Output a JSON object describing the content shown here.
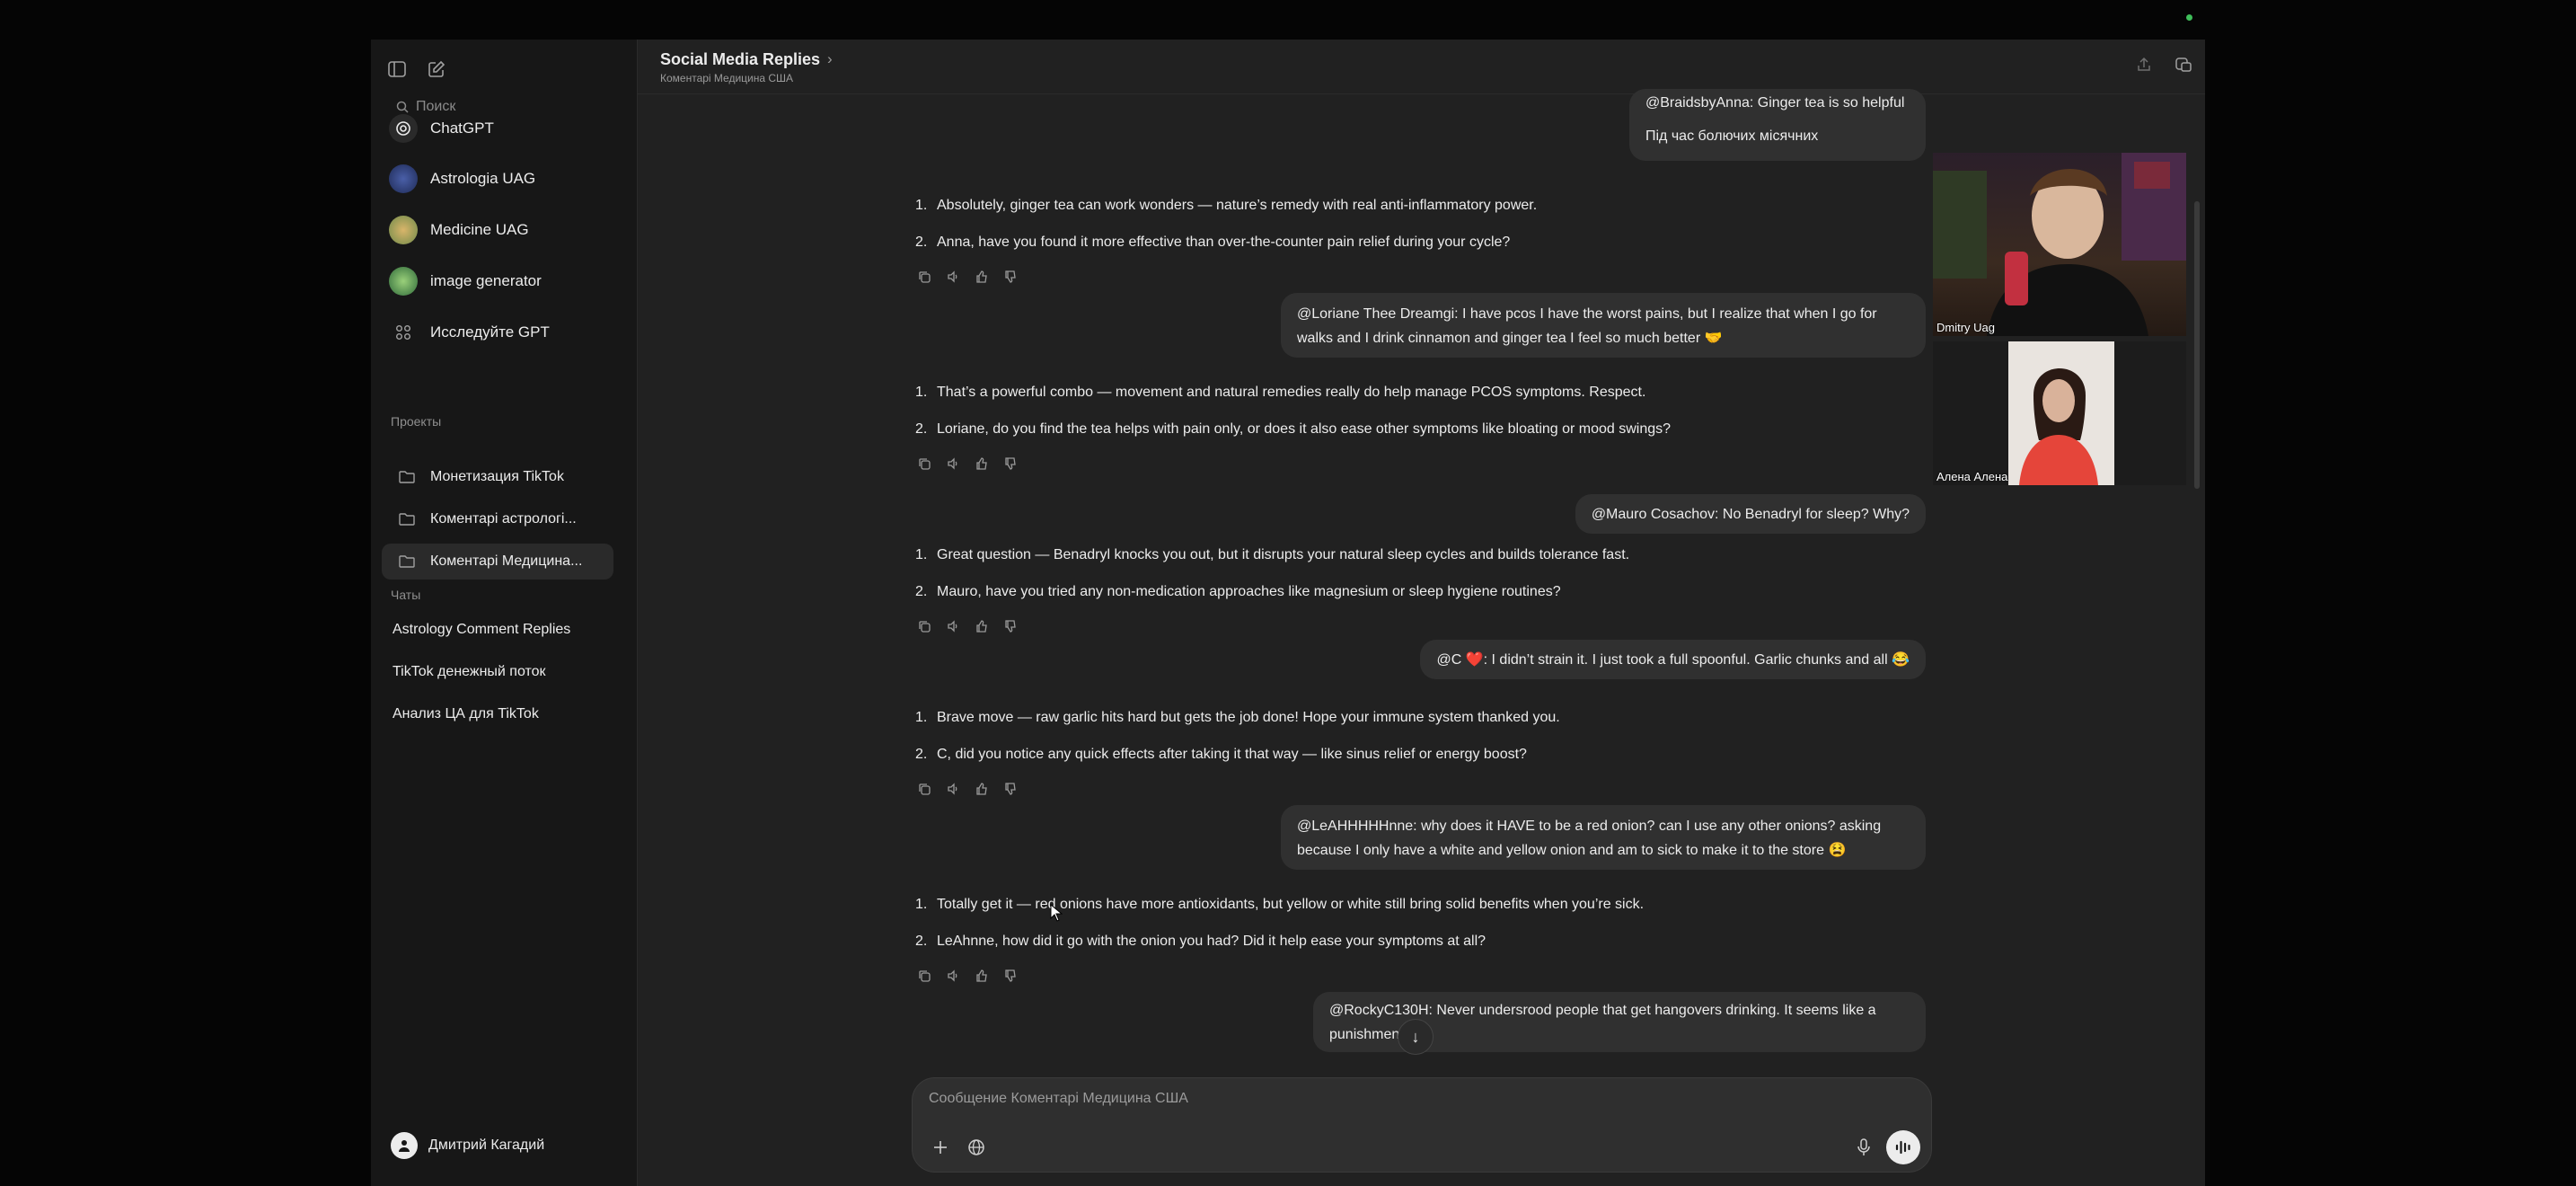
{
  "sidebar": {
    "search_placeholder": "Поиск",
    "gpts": [
      {
        "label": "ChatGPT",
        "icon": "chatgpt-logo-icon"
      },
      {
        "label": "Astrologia UAG",
        "icon": "astrology-avatar-icon"
      },
      {
        "label": "Medicine UAG",
        "icon": "medicine-avatar-icon"
      },
      {
        "label": "image generator",
        "icon": "image-generator-avatar-icon"
      },
      {
        "label": "Исследуйте GPT",
        "icon": "grid-icon"
      }
    ],
    "projects_label": "Проекты",
    "projects": [
      {
        "label": "Монетизация TikTok"
      },
      {
        "label": "Коментарі астрологі..."
      },
      {
        "label": "Коментарі Медицина..."
      }
    ],
    "chats_label": "Чаты",
    "chats": [
      {
        "label": "Astrology Comment Replies"
      },
      {
        "label": "TikTok денежный поток"
      },
      {
        "label": "Анализ ЦА для TikTok"
      }
    ],
    "user_name": "Дмитрий Кагадий"
  },
  "header": {
    "title": "Social Media Replies",
    "subtitle": "Коментарі Медицина США"
  },
  "conversation": [
    {
      "role": "user",
      "lines": [
        "@BraidsbyAnna: Ginger tea is so helpful",
        "Під час болючих місячних"
      ]
    },
    {
      "role": "assistant",
      "items": [
        "Absolutely, ginger tea can work wonders — nature’s remedy with real anti-inflammatory power.",
        "Anna, have you found it more effective than over-the-counter pain relief during your cycle?"
      ]
    },
    {
      "role": "user",
      "lines": [
        "@Loriane Thee Dreamgi: I have pcos I have the worst pains, but I realize that when I go for",
        "walks and I drink cinnamon and ginger tea I feel so much better 🤝"
      ]
    },
    {
      "role": "assistant",
      "items": [
        "That’s a powerful combo — movement and natural remedies really do help manage PCOS symptoms. Respect.",
        "Loriane, do you find the tea helps with pain only, or does it also ease other symptoms like bloating or mood swings?"
      ]
    },
    {
      "role": "user",
      "lines": [
        "@Mauro Cosachov: No Benadryl for sleep? Why?"
      ]
    },
    {
      "role": "assistant",
      "items": [
        "Great question — Benadryl knocks you out, but it disrupts your natural sleep cycles and builds tolerance fast.",
        "Mauro, have you tried any non-medication approaches like magnesium or sleep hygiene routines?"
      ]
    },
    {
      "role": "user",
      "lines": [
        "@C ❤️: I didn’t strain it. I just took a full spoonful. Garlic chunks and all 😂"
      ]
    },
    {
      "role": "assistant",
      "items": [
        "Brave move — raw garlic hits hard but gets the job done! Hope your immune system thanked you.",
        "C, did you notice any quick effects after taking it that way — like sinus relief or energy boost?"
      ]
    },
    {
      "role": "user",
      "lines": [
        "@LeAHHHHHnne: why does it HAVE to be a red onion? can I use any other onions? asking",
        "because I only have a white and yellow onion and am to sick to make it to the store 😫"
      ]
    },
    {
      "role": "assistant",
      "items": [
        "Totally get it — red onions have more antioxidants, but yellow or white still bring solid benefits when you’re sick.",
        "LeAhnne, how did it go with the onion you had? Did it help ease your symptoms at all?"
      ]
    },
    {
      "role": "user",
      "lines": [
        "@RockyC130H: Never undersrood people that get hangovers drinking. It seems like a",
        "punishment"
      ]
    }
  ],
  "composer": {
    "placeholder": "Сообщение Коментарі Медицина США"
  },
  "video_tiles": [
    {
      "name": "Dmitry Uag"
    },
    {
      "name": "Алена Алена"
    }
  ],
  "colors": {
    "app_bg": "#212121",
    "sidebar_bg": "#171717",
    "bubble_bg": "#303030",
    "text": "#ececec"
  }
}
